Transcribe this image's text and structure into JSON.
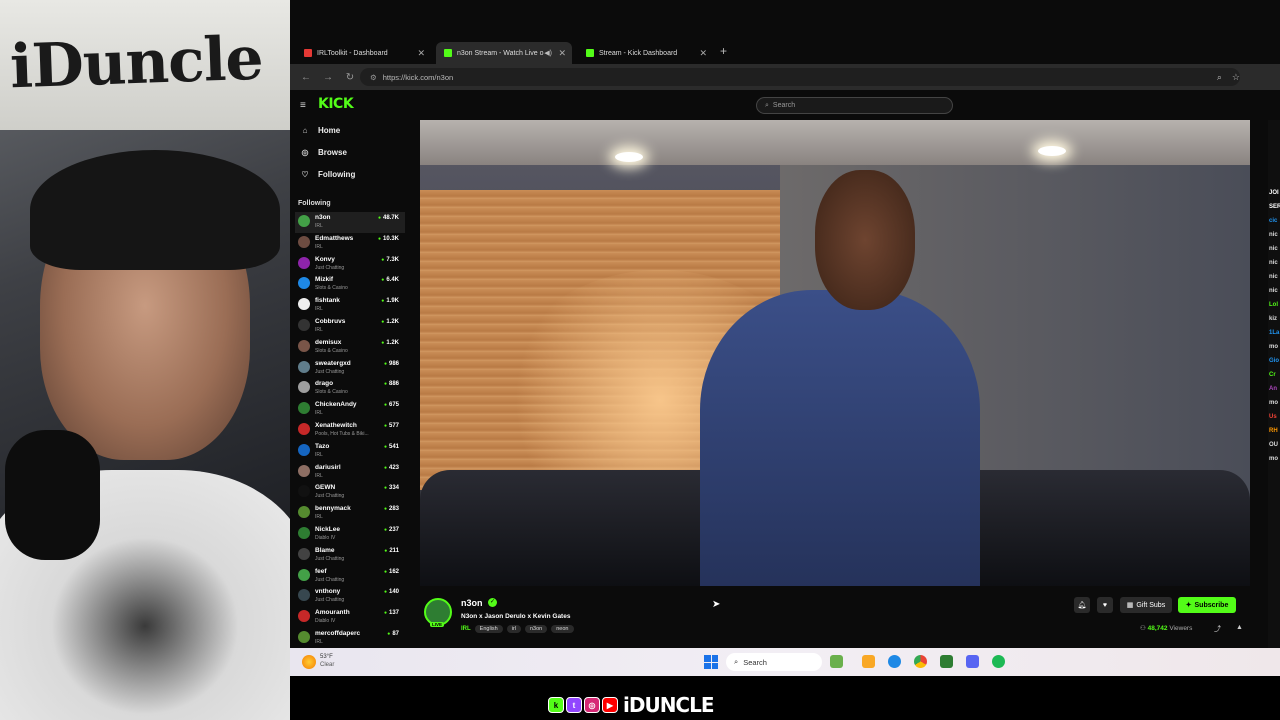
{
  "webcam": {
    "banner_text": "iDuncle"
  },
  "browser": {
    "tabs": [
      {
        "label": "IRLToolkit - Dashboard",
        "color": "#e53935"
      },
      {
        "label": "n3on Stream - Watch Live o",
        "color": "#53fc18"
      },
      {
        "label": "Stream - Kick Dashboard",
        "color": "#53fc18"
      }
    ],
    "new_tab": "+",
    "url": "https://kick.com/n3on"
  },
  "kick": {
    "logo": "KICK",
    "search_placeholder": "Search",
    "nav": [
      {
        "label": "Home",
        "icon": "home-icon",
        "glyph": "⌂"
      },
      {
        "label": "Browse",
        "icon": "browse-icon",
        "glyph": "◎"
      },
      {
        "label": "Following",
        "icon": "heart-icon",
        "glyph": "♡"
      }
    ],
    "following_title": "Following",
    "channels": [
      {
        "name": "n3on",
        "category": "IRL",
        "viewers": "48.7K",
        "color": "#43a047"
      },
      {
        "name": "Edmatthews",
        "category": "IRL",
        "viewers": "10.3K",
        "color": "#6d4c41"
      },
      {
        "name": "Konvy",
        "category": "Just Chatting",
        "viewers": "7.3K",
        "color": "#8e24aa"
      },
      {
        "name": "Mizkif",
        "category": "Slots & Casino",
        "viewers": "6.4K",
        "color": "#1e88e5"
      },
      {
        "name": "fishtank",
        "category": "IRL",
        "viewers": "1.9K",
        "color": "#eeeeee"
      },
      {
        "name": "Cobbruvs",
        "category": "IRL",
        "viewers": "1.2K",
        "color": "#333333"
      },
      {
        "name": "demisux",
        "category": "Slots & Casino",
        "viewers": "1.2K",
        "color": "#795548"
      },
      {
        "name": "sweatergxd",
        "category": "Just Chatting",
        "viewers": "986",
        "color": "#607d8b"
      },
      {
        "name": "drago",
        "category": "Slots & Casino",
        "viewers": "886",
        "color": "#9e9e9e"
      },
      {
        "name": "ChickenAndy",
        "category": "IRL",
        "viewers": "675",
        "color": "#2e7d32"
      },
      {
        "name": "Xenathewitch",
        "category": "Pools, Hot Tubs & Biki...",
        "viewers": "577",
        "color": "#c62828"
      },
      {
        "name": "Tazo",
        "category": "IRL",
        "viewers": "541",
        "color": "#1565c0"
      },
      {
        "name": "dariusirl",
        "category": "IRL",
        "viewers": "423",
        "color": "#8d6e63"
      },
      {
        "name": "GEWN",
        "category": "Just Chatting",
        "viewers": "334",
        "color": "#111111"
      },
      {
        "name": "bennymack",
        "category": "IRL",
        "viewers": "283",
        "color": "#558b2f"
      },
      {
        "name": "NickLee",
        "category": "Diablo IV",
        "viewers": "237",
        "color": "#2e7d32"
      },
      {
        "name": "Blame",
        "category": "Just Chatting",
        "viewers": "211",
        "color": "#424242"
      },
      {
        "name": "feef",
        "category": "Just Chatting",
        "viewers": "162",
        "color": "#43a047"
      },
      {
        "name": "vnthony",
        "category": "Just Chatting",
        "viewers": "140",
        "color": "#37474f"
      },
      {
        "name": "Amouranth",
        "category": "Diablo IV",
        "viewers": "137",
        "color": "#c62828"
      },
      {
        "name": "mercoffdaperc",
        "category": "IRL",
        "viewers": "87",
        "color": "#558b2f"
      }
    ],
    "stream": {
      "channel": "n3on",
      "live_badge": "LIVE",
      "title": "N3on x Jason Derulo x Kevin Gates",
      "category": "IRL",
      "tags": [
        "English",
        "irl",
        "n3on",
        "neon"
      ],
      "gift_subs": "Gift Subs",
      "subscribe": "Subscribe",
      "viewer_count": "48,742",
      "viewers_label": "Viewers"
    },
    "chat_fragments": [
      {
        "text": "JOI",
        "color": "#ffffff"
      },
      {
        "text": "SER",
        "color": "#ffffff"
      },
      {
        "text": "cic",
        "color": "#2196f3"
      },
      {
        "text": "nic",
        "color": "#dddddd"
      },
      {
        "text": "nic",
        "color": "#dddddd"
      },
      {
        "text": "nic",
        "color": "#dddddd"
      },
      {
        "text": "nic",
        "color": "#dddddd"
      },
      {
        "text": "nic",
        "color": "#dddddd"
      },
      {
        "text": "Lol",
        "color": "#53fc18"
      },
      {
        "text": "kiz",
        "color": "#dddddd"
      },
      {
        "text": "1La",
        "color": "#2196f3"
      },
      {
        "text": "mo",
        "color": "#dddddd"
      },
      {
        "text": "Gio",
        "color": "#2196f3"
      },
      {
        "text": "Cr",
        "color": "#53fc18"
      },
      {
        "text": "An",
        "color": "#ab47bc"
      },
      {
        "text": "mo",
        "color": "#dddddd"
      },
      {
        "text": "Us",
        "color": "#f44336"
      },
      {
        "text": "RH",
        "color": "#ff9800"
      },
      {
        "text": "OU",
        "color": "#dddddd"
      },
      {
        "text": "mo",
        "color": "#dddddd"
      }
    ]
  },
  "taskbar": {
    "temperature": "53°F",
    "condition": "Clear",
    "search": "Search"
  },
  "branding": {
    "text": "iDUNCLE"
  }
}
